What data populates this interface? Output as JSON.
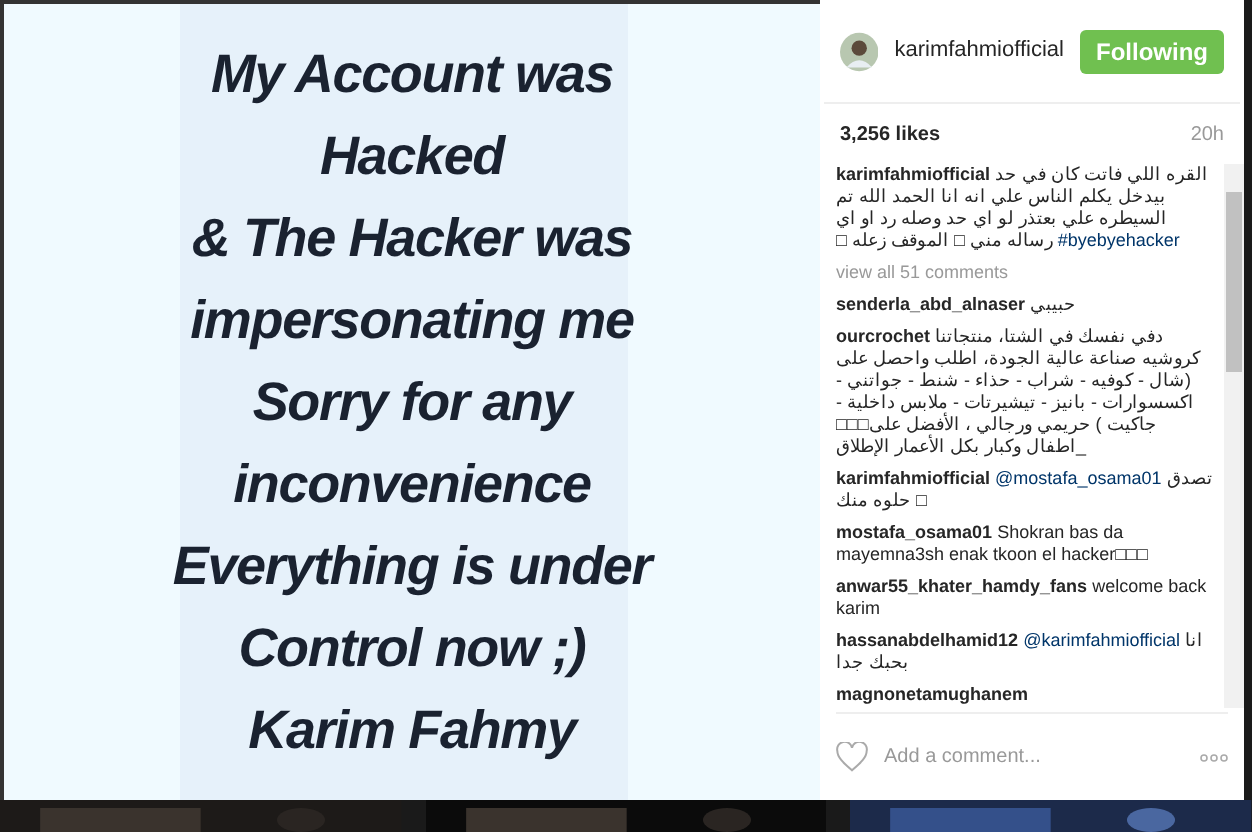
{
  "post_text": [
    "My Account was",
    "Hacked",
    "& The Hacker was",
    "impersonating me",
    "Sorry for any",
    "inconvenience",
    "Everything is under",
    "Control now ;)",
    "Karim Fahmy"
  ],
  "header": {
    "username": "karimfahmiofficial",
    "follow_button": {
      "label": "Following",
      "selected": true
    }
  },
  "likes": "3,256 likes",
  "time": "20h",
  "caption": {
    "user": "karimfahmiofficial",
    "text": "القره اللي فاتت كان في حد بيدخل يكلم الناس علي انه انا الحمد الله تم السيطره علي بعتذر لو اي حد وصله رد او اي رساله مني □ الموقف زعله □",
    "hashtag": "#byebyehacker"
  },
  "view_all": "view all 51 comments",
  "comments": [
    {
      "user": "senderla_abd_alnaser",
      "text": "حبيبي"
    },
    {
      "user": "ourcrochet",
      "text": "دفي نفسك في الشتا، منتجاتنا كروشيه صناعة عالية الجودة، اطلب واحصل على (شال - كوفيه - شراب - حذاء - شنط - جواتني - اكسسوارات - بانيز - تيشيرتات - ملابس داخلية - جاكيت ) حريمي ورجالي ، الأفضل على□□□ _اطفال وكبار بكل الأعمار الإطلاق"
    },
    {
      "user": "karimfahmiofficial",
      "mention": "@mostafa_osama01",
      "text": "تصدق حلوه منك □"
    },
    {
      "user": "mostafa_osama01",
      "text": "Shokran bas da mayemna3sh enak tkoon el hacker□□□"
    },
    {
      "user": "anwar55_khater_hamdy_fans",
      "text": "welcome back karim"
    },
    {
      "user": "hassanabdelhamid12",
      "mention": "@karimfahmiofficial",
      "text": "انا بحبك جدا"
    },
    {
      "user": "magnonetamughanem"
    }
  ],
  "add_comment": {
    "placeholder": "Add a comment..."
  }
}
